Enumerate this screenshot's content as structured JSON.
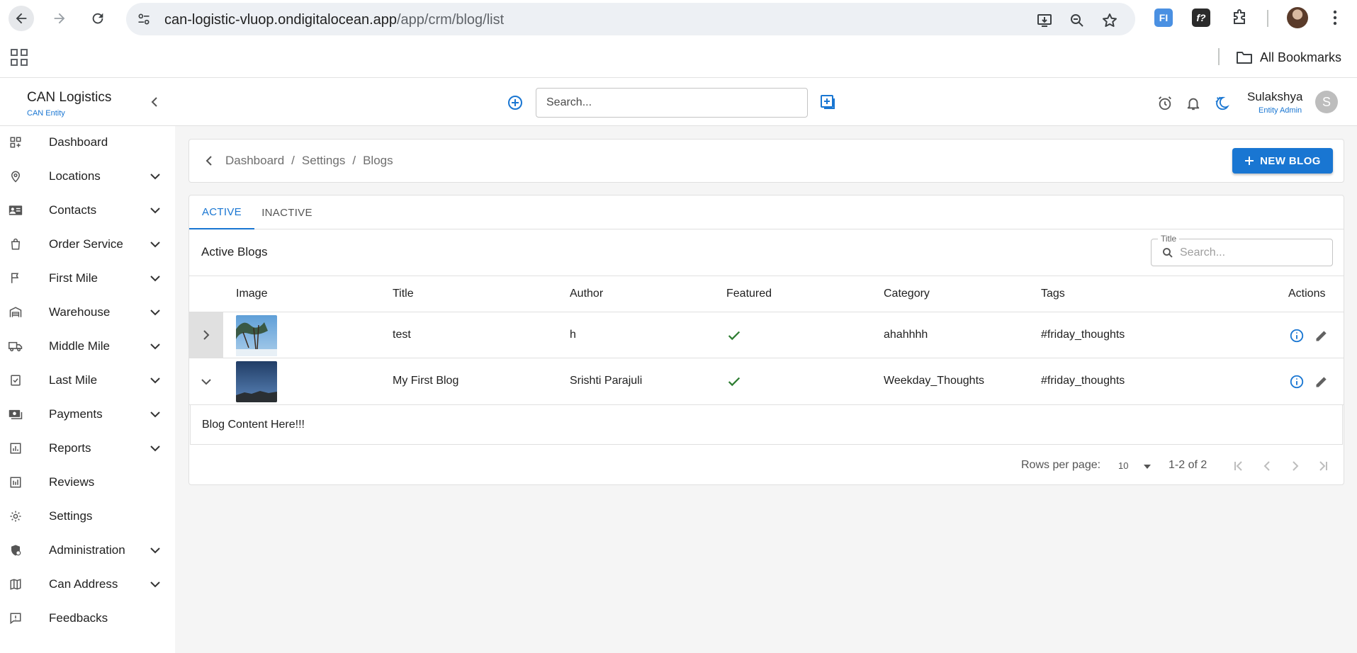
{
  "browser": {
    "url_host": "can-logistic-vluop.ondigitalocean.app",
    "url_path": "/app/crm/blog/list",
    "bookmarks_label": "All Bookmarks",
    "extensions": [
      "FI",
      "f?"
    ]
  },
  "header": {
    "brand_title": "CAN Logistics",
    "brand_subtitle": "CAN Entity",
    "search_placeholder": "Search...",
    "user_name": "Sulakshya",
    "user_role": "Entity Admin",
    "user_initial": "S"
  },
  "sidebar": {
    "items": [
      {
        "label": "Dashboard",
        "icon": "dashboard-icon",
        "expandable": false
      },
      {
        "label": "Locations",
        "icon": "location-pin-icon",
        "expandable": true
      },
      {
        "label": "Contacts",
        "icon": "contact-card-icon",
        "expandable": true
      },
      {
        "label": "Order Service",
        "icon": "shopping-bag-icon",
        "expandable": true
      },
      {
        "label": "First Mile",
        "icon": "flag-icon",
        "expandable": true
      },
      {
        "label": "Warehouse",
        "icon": "warehouse-icon",
        "expandable": true
      },
      {
        "label": "Middle Mile",
        "icon": "truck-icon",
        "expandable": true
      },
      {
        "label": "Last Mile",
        "icon": "checklist-icon",
        "expandable": true
      },
      {
        "label": "Payments",
        "icon": "payments-icon",
        "expandable": true
      },
      {
        "label": "Reports",
        "icon": "bar-chart-icon",
        "expandable": true
      },
      {
        "label": "Reviews",
        "icon": "reviews-icon",
        "expandable": false
      },
      {
        "label": "Settings",
        "icon": "gear-icon",
        "expandable": false
      },
      {
        "label": "Administration",
        "icon": "admin-shield-icon",
        "expandable": true
      },
      {
        "label": "Can Address",
        "icon": "map-icon",
        "expandable": true
      },
      {
        "label": "Feedbacks",
        "icon": "feedback-icon",
        "expandable": false
      }
    ]
  },
  "breadcrumb": [
    "Dashboard",
    "/",
    "Settings",
    "/",
    "Blogs"
  ],
  "new_blog_label": "NEW BLOG",
  "tabs": {
    "active": "ACTIVE",
    "inactive": "INACTIVE"
  },
  "list": {
    "title": "Active Blogs",
    "filter_label": "Title",
    "filter_placeholder": "Search...",
    "columns": {
      "image": "Image",
      "title": "Title",
      "author": "Author",
      "featured": "Featured",
      "category": "Category",
      "tags": "Tags",
      "actions": "Actions"
    },
    "rows": [
      {
        "title": "test",
        "author": "h",
        "featured": true,
        "category": "ahahhhh",
        "tags": "#friday_thoughts",
        "expanded": false
      },
      {
        "title": "My First Blog",
        "author": "Srishti Parajuli",
        "featured": true,
        "category": "Weekday_Thoughts",
        "tags": "#friday_thoughts",
        "expanded": true
      }
    ],
    "detail_content": "Blog Content Here!!!"
  },
  "pagination": {
    "rows_per_page_label": "Rows per page:",
    "rows_per_page_value": "10",
    "range": "1-2 of 2"
  },
  "colors": {
    "primary": "#1976d2",
    "success": "#2e7d32",
    "background": "#f5f5f5"
  }
}
